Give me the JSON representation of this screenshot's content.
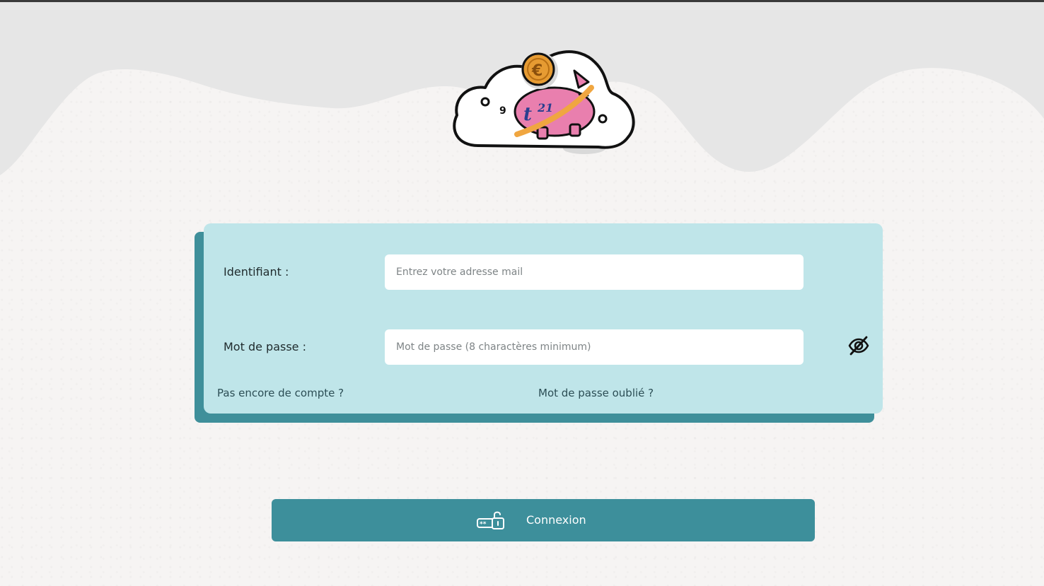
{
  "login_form": {
    "identifier_label": "Identifiant :",
    "identifier_placeholder": "Entrez votre adresse mail",
    "identifier_value": "",
    "password_label": "Mot de passe :",
    "password_placeholder": "Mot de passe (8 charactères minimum)",
    "password_value": "",
    "password_visibility_icon": "eye-off-icon",
    "signup_link": "Pas encore de compte ?",
    "forgot_link": "Mot de passe oublié ?"
  },
  "login_button": {
    "label": "Connexion",
    "icon": "password-lock-icon"
  },
  "colors": {
    "header_background": "#e6e6e6",
    "page_background": "#f6f4f3",
    "card_background": "#bfe5e9",
    "accent": "#3d8f9b"
  }
}
